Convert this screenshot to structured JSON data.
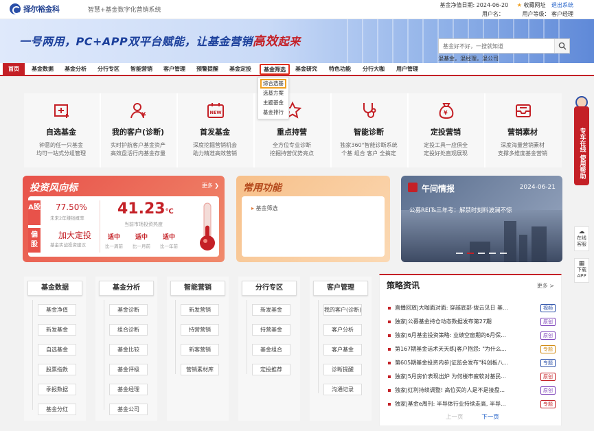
{
  "top": {
    "brand": "择尔裕金科",
    "system_name": "智慧+基金数字化营销系统",
    "nav_date_label": "基金净值日期: 2024-06-20",
    "favorite": "收藏网址",
    "logout": "退出系统",
    "user_label": "用户名：",
    "user_level_label": "用户等级：",
    "user_level": "客户经理"
  },
  "banner": {
    "slogan_part1": "一号两用，PC+APP",
    "slogan_part2": "双平台赋能，让基金营销",
    "slogan_part3": "高效",
    "slogan_part4": "起来",
    "search_placeholder": "基金好不好，一搜就知道",
    "hot_words": "混基金，混经理，混公司"
  },
  "nav": {
    "items": [
      "首页",
      "基金数据",
      "基金分析",
      "分行专区",
      "智能营销",
      "客户管理",
      "预警提醒",
      "基金定投",
      "基金筛选",
      "基金研究",
      "特色功能",
      "分行大咖",
      "用户管理"
    ]
  },
  "dropdown": [
    "综合选基",
    "选基方案",
    "主题基金",
    "基金排行"
  ],
  "features": [
    {
      "title": "自选基金",
      "desc1": "钟意的任一只基金",
      "desc2": "均可一站式分组管理",
      "icon": "folder-plus-icon"
    },
    {
      "title": "我的客户(诊断)",
      "desc1": "实时护航客户基金资产",
      "desc2": "高效盘活行内基金存量",
      "icon": "client-icon"
    },
    {
      "title": "首发基金",
      "desc1": "深度挖掘营销机会",
      "desc2": "助力精准高效营销",
      "icon": "new-calendar-icon"
    },
    {
      "title": "重点持营",
      "desc1": "全方位专业诊断",
      "desc2": "挖掘持营优势亮点",
      "icon": "star-icon"
    },
    {
      "title": "智能诊断",
      "desc1": "独家360°智能诊断系统",
      "desc2": "个基 组合 客户 全搞定",
      "icon": "stethoscope-icon"
    },
    {
      "title": "定投营销",
      "desc1": "定投工具一应俱全",
      "desc2": "定投好处直观展现",
      "icon": "money-bag-icon"
    },
    {
      "title": "营销素材",
      "desc1": "深度海量营销素材",
      "desc2": "支撑多维度基金营销",
      "icon": "inbox-icon"
    }
  ],
  "risk": {
    "title": "投资风向标",
    "more": "更多",
    "tag_a": "A股",
    "tag_b": "偏股",
    "a_value": "77.50%",
    "a_desc": "未来2年赚钱概率",
    "b_value": "加大定投",
    "b_desc": "基金实战投资建议",
    "temperature": "41.23",
    "temp_unit": "℃",
    "temp_label": "当前市场投资热度",
    "thermometer_level": 0.41,
    "chips": [
      {
        "value": "适中",
        "label": "比一周前"
      },
      {
        "value": "适中",
        "label": "比一月前"
      },
      {
        "value": "适中",
        "label": "比一年前"
      }
    ]
  },
  "common": {
    "title": "常用功能",
    "item": "基金筛选"
  },
  "midday": {
    "title": "午间情报",
    "date": "2024-06-21",
    "headline": "公募REITs三年考：解禁时刻料波澜不惊"
  },
  "quick": [
    {
      "head": "基金数据",
      "items": [
        "基金净值",
        "新发基金",
        "自选基金",
        "股票指数",
        "季报数据",
        "基金分红"
      ]
    },
    {
      "head": "基金分析",
      "items": [
        "基金诊断",
        "组合诊断",
        "基金比较",
        "基金评级",
        "基金经理",
        "基金公司"
      ]
    },
    {
      "head": "智能营销",
      "items": [
        "新发营销",
        "持营营销",
        "新客营销",
        "营销素材库"
      ]
    },
    {
      "head": "分行专区",
      "items": [
        "新发基金",
        "持营基金",
        "基金组合",
        "定投推荐"
      ]
    },
    {
      "head": "客户管理",
      "items": [
        "我的客户(诊断)",
        "客户分析",
        "客户基金",
        "诊断提醒",
        "沟通记录"
      ]
    }
  ],
  "news": {
    "title": "策略资讯",
    "more": "更多 >",
    "items": [
      {
        "text": "直播回放|大咖面对面: 穿越底部·拨云见日 基...",
        "tag": "视频",
        "tag_color": "#2a4fa8"
      },
      {
        "text": "独家|公募基金持仓动态数据发布第27期",
        "tag": "原创",
        "tag_color": "#7a3fb8"
      },
      {
        "text": "独家|6月基金投资策略: 业绩空窗期的6月保...",
        "tag": "原创",
        "tag_color": "#7a3fb8"
      },
      {
        "text": "第167期基金话术天天练|客户抱怨: \"为什么...",
        "tag": "专题",
        "tag_color": "#d08a12"
      },
      {
        "text": "第605期基金投资内参|证监会发布\"科创板八...",
        "tag": "专题",
        "tag_color": "#2a4fa8"
      },
      {
        "text": "独家|5月房价表现出炉 为何楼市疲软对基民...",
        "tag": "原创",
        "tag_color": "#c42026"
      },
      {
        "text": "独家|红利持续调整! 高位买的人是不是接盘...",
        "tag": "原创",
        "tag_color": "#7a3fb8"
      },
      {
        "text": "独家|基金e周刊: 半导体行业持续走高, 半导...",
        "tag": "专题",
        "tag_color": "#c42026"
      }
    ],
    "prev": "上一页",
    "next": "下一页"
  },
  "side": {
    "help": "专车在线 使用帮助",
    "online": "在线客服",
    "download": "下载APP"
  }
}
